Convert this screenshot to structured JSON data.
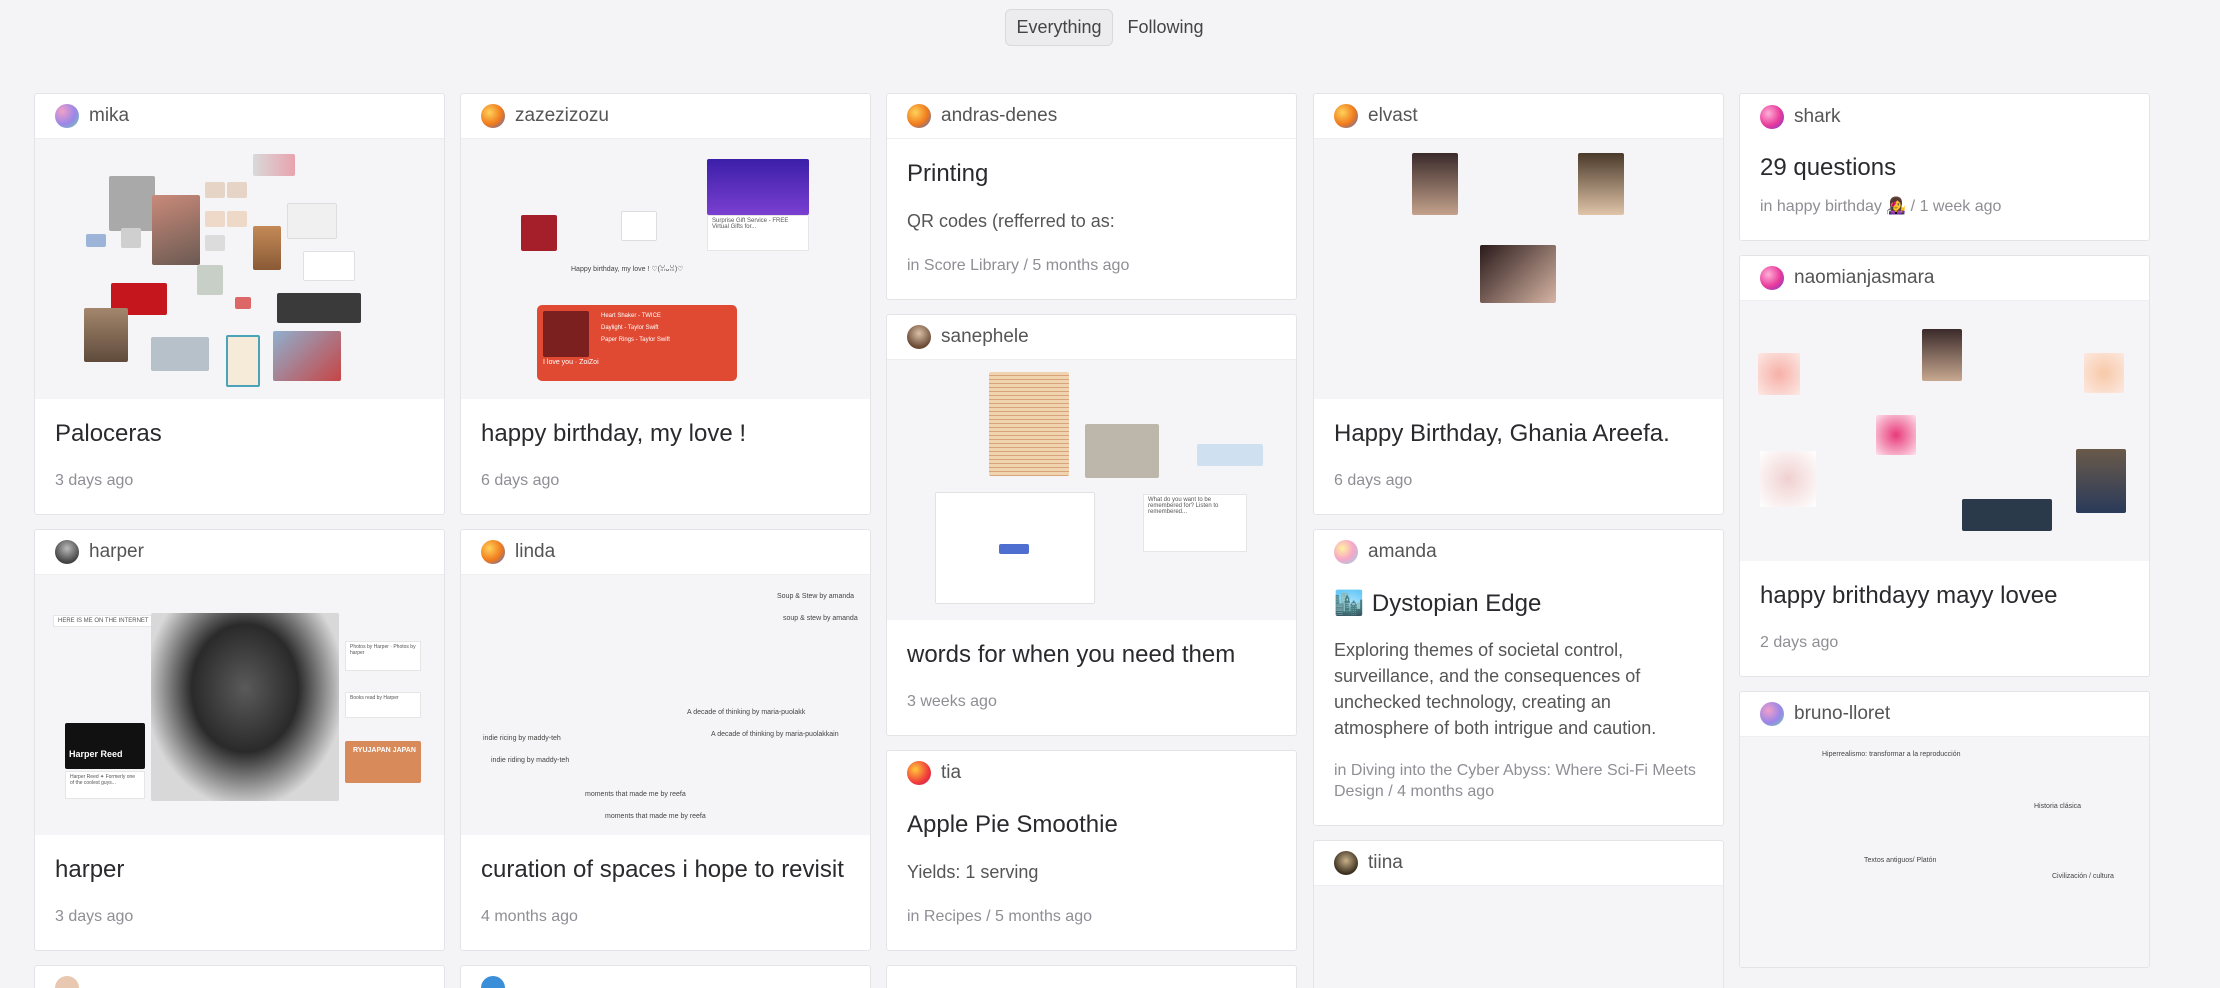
{
  "tabs": {
    "everything": "Everything",
    "following": "Following"
  },
  "cards": {
    "mika": {
      "user": "mika",
      "title": "Paloceras",
      "meta": "3 days ago"
    },
    "harper": {
      "user": "harper",
      "title": "harper",
      "meta": "3 days ago",
      "preview": {
        "note": "HERE IS ME ON THE INTERNET",
        "photos": "Photos by Harper · Photos by harper",
        "books": "Books read by Harper",
        "japan": "RYUJAPAN JAPAN",
        "book_title": "Harper Reed",
        "book_sub": "Harper Reed ✦ Formerly one of the coolest guys..."
      }
    },
    "zazezizozu": {
      "user": "zazezizozu",
      "title": "happy birthday, my love !",
      "meta": "6 days ago",
      "preview": {
        "gift_text": "Surprise Gift Service - FREE Virtual Gifts for...",
        "caption": "Happy birthday, my love ! ♡(ꈍᴗꈍ)♡",
        "songs": [
          "Heart Shaker - TWICE",
          "Daylight - Taylor Swift",
          "Paper Rings - Taylor Swift"
        ],
        "playlist": "I love you · ZoiZoi"
      }
    },
    "linda": {
      "user": "linda",
      "title": "curation of spaces i hope to revisit",
      "meta": "4 months ago",
      "preview": {
        "items": [
          "Soup & Stew by amanda",
          "soup & stew by amanda",
          "A decade of thinking by maria-puolakk",
          "A decade of thinking by maria-puolakkain",
          "indie ricing by maddy-teh",
          "indie riding by maddy-teh",
          "moments that made me by reefa",
          "moments that made me by reefa"
        ]
      }
    },
    "andras": {
      "user": "andras-denes",
      "title": "Printing",
      "excerpt": "QR codes (refferred to as:",
      "meta": "in Score Library / 5 months ago"
    },
    "sanephele": {
      "user": "sanephele",
      "title": "words for when you need them",
      "meta": "3 weeks ago",
      "preview": {
        "note": "What do you want to be remembered for? Listen to remembered..."
      }
    },
    "tia": {
      "user": "tia",
      "title": "Apple Pie Smoothie",
      "excerpt": "Yields: 1 serving",
      "meta": "in Recipes / 5 months ago"
    },
    "elvast": {
      "user": "elvast",
      "title": "Happy Birthday, Ghania Areefa.",
      "meta": "6 days ago"
    },
    "amanda": {
      "user": "amanda",
      "emoji": "🏙️",
      "title": "Dystopian Edge",
      "excerpt": "Exploring themes of societal control, surveillance, and the consequences of unchecked technology, creating an atmosphere of both intrigue and caution.",
      "meta": "in Diving into the Cyber Abyss: Where Sci-Fi Meets Design / 4 months ago"
    },
    "tiina": {
      "user": "tiina"
    },
    "shark": {
      "user": "shark",
      "title": "29 questions",
      "meta": "in happy birthday 👩‍🎤 / 1 week ago"
    },
    "naomi": {
      "user": "naomianjasmara",
      "title": "happy brithdayy mayy lovee",
      "meta": "2 days ago"
    },
    "bruno": {
      "user": "bruno-lloret",
      "preview": {
        "labels": [
          "Hiperrealismo: transformar a la reproducción",
          "Historia clásica",
          "Textos antiguos/ Platón",
          "Civilización / cultura"
        ]
      }
    }
  },
  "colors": {
    "background": "#f4f4f6",
    "card": "#ffffff",
    "meta": "#8e8e95"
  }
}
